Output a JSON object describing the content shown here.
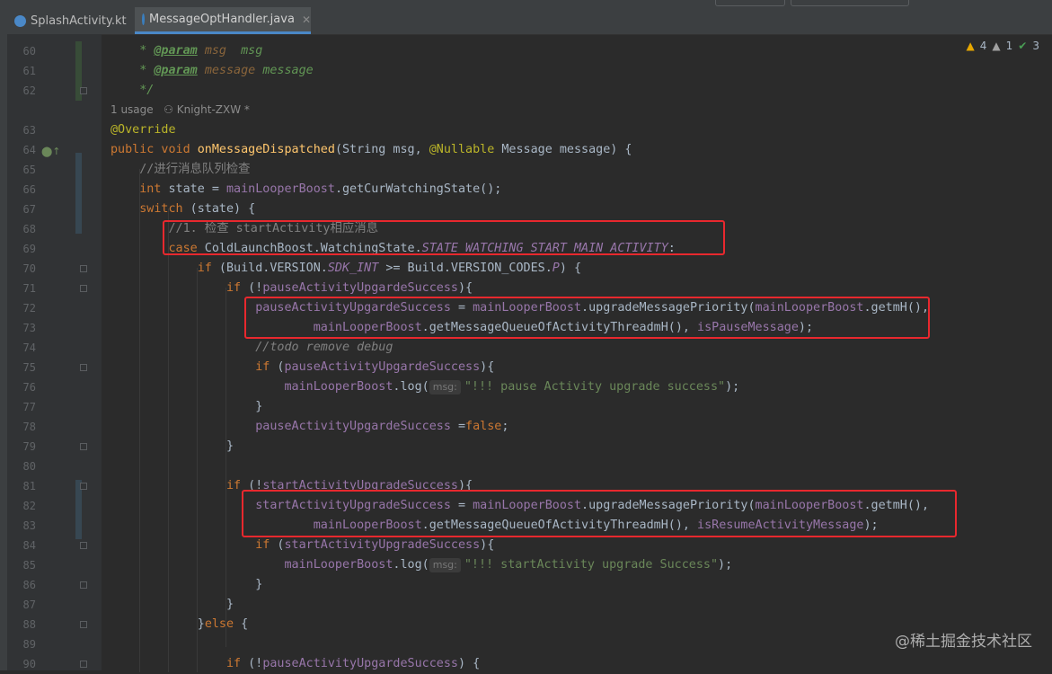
{
  "tabs": [
    {
      "label": "SplashActivity.kt",
      "active": false
    },
    {
      "label": "MessageOptHandler.java",
      "active": true
    }
  ],
  "inspections": {
    "warnings": "4",
    "weak_warnings": "1",
    "ok": "3"
  },
  "code_meta": {
    "usages": "1 usage",
    "author": "Knight-ZXW *"
  },
  "param_hint": "msg:",
  "line_numbers": [
    "60",
    "61",
    "62",
    "63",
    "64",
    "65",
    "66",
    "67",
    "68",
    "69",
    "70",
    "71",
    "72",
    "73",
    "74",
    "75",
    "76",
    "77",
    "78",
    "79",
    "80",
    "81",
    "82",
    "83",
    "84",
    "85",
    "86",
    "87",
    "88",
    "89",
    "90"
  ],
  "code": {
    "l60_tag": "@param",
    "l60_name": "msg",
    "l60_desc": "msg",
    "l61_tag": "@param",
    "l61_name": "message",
    "l61_desc": "message",
    "l62": "*/",
    "l63": "@Override",
    "l64_kw": "public void",
    "l64_fn": "onMessageDispatched",
    "l64_a": "(String msg, ",
    "l64_ann": "@Nullable",
    "l64_b": " Message message) {",
    "l65": "//进行消息队列检查",
    "l66_kw": "int",
    "l66_a": " state = ",
    "l66_f": "mainLooperBoost",
    "l66_b": ".getCurWatchingState();",
    "l67_kw": "switch",
    "l67_a": " (state) {",
    "l68": "//1. 检查 startActivity相应消息",
    "l69_kw": "case",
    "l69_a": " ColdLaunchBoost.WatchingState.",
    "l69_c": "STATE_WATCHING_START_MAIN_ACTIVITY",
    "l69_b": ":",
    "l70_kw": "if",
    "l70_a": " (Build.VERSION.",
    "l70_c": "SDK_INT",
    "l70_b": " >= Build.VERSION_CODES.",
    "l70_d": "P",
    "l70_e": ") {",
    "l71_kw": "if",
    "l71_a": " (!",
    "l71_f": "pauseActivityUpgardeSuccess",
    "l71_b": "){",
    "l72_f1": "pauseActivityUpgardeSuccess",
    "l72_a": " = ",
    "l72_f2": "mainLooperBoost",
    "l72_b": ".upgradeMessagePriority(",
    "l72_f3": "mainLooperBoost",
    "l72_c": ".getmH(),",
    "l73_f1": "mainLooperBoost",
    "l73_a": ".getMessageQueueOfActivityThreadmH(), ",
    "l73_f2": "isPauseMessage",
    "l73_b": ");",
    "l74": "//todo remove debug",
    "l75_kw": "if",
    "l75_a": " (",
    "l75_f": "pauseActivityUpgardeSuccess",
    "l75_b": "){",
    "l76_f": "mainLooperBoost",
    "l76_a": ".log(",
    "l76_s": "\"!!! pause Activity upgrade success\"",
    "l76_b": ");",
    "l77": "}",
    "l78_f": "pauseActivityUpgardeSuccess",
    "l78_a": " =",
    "l78_kw": "false",
    "l78_b": ";",
    "l79": "}",
    "l81_kw": "if",
    "l81_a": " (!",
    "l81_f": "startActivityUpgradeSuccess",
    "l81_b": "){",
    "l82_f1": "startActivityUpgradeSuccess",
    "l82_a": " = ",
    "l82_f2": "mainLooperBoost",
    "l82_b": ".upgradeMessagePriority(",
    "l82_f3": "mainLooperBoost",
    "l82_c": ".getmH(),",
    "l83_f1": "mainLooperBoost",
    "l83_a": ".getMessageQueueOfActivityThreadmH(), ",
    "l83_f2": "isResumeActivityMessage",
    "l83_b": ");",
    "l84_kw": "if",
    "l84_a": " (",
    "l84_f": "startActivityUpgradeSuccess",
    "l84_b": "){",
    "l85_f": "mainLooperBoost",
    "l85_a": ".log(",
    "l85_s": "\"!!! startActivity upgrade Success\"",
    "l85_b": ");",
    "l86": "}",
    "l87": "}",
    "l88_a": "}",
    "l88_kw": "else",
    "l88_b": " {",
    "l90_kw": "if",
    "l90_a": " (!",
    "l90_f": "pauseActivityUpgardeSuccess",
    "l90_b": ") {"
  },
  "watermark": "@稀土掘金技术社区"
}
